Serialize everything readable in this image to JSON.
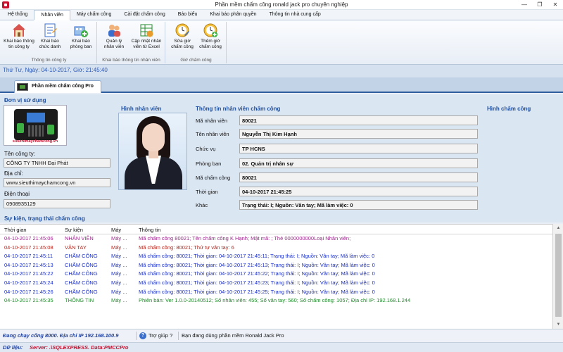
{
  "window": {
    "title": "Phần mềm chấm công ronald jack pro chuyên nghiệp",
    "minimize": "—",
    "maximize": "❐",
    "close": "✕"
  },
  "ribbon": {
    "tabs": [
      "Hệ thống",
      "Nhân viên",
      "Máy chấm công",
      "Cài đặt chấm công",
      "Báo biểu",
      "Khai báo  phân quyền",
      "Thông tin nhà cung cấp"
    ],
    "active_tab": 1,
    "groups": [
      {
        "label": "Thông tin công ty",
        "buttons": [
          {
            "label1": "Khai báo thông",
            "label2": "tin công ty",
            "icon": "house-icon"
          },
          {
            "label1": "Khai báo",
            "label2": "chức danh",
            "icon": "form-icon"
          },
          {
            "label1": "Khai báo",
            "label2": "phòng ban",
            "icon": "department-icon"
          }
        ]
      },
      {
        "label": "Khai báo thông tin nhân viên",
        "buttons": [
          {
            "label1": "Quản lý",
            "label2": "nhân viên",
            "icon": "people-icon"
          },
          {
            "label1": "Cập nhật nhân",
            "label2": "viên từ Excel",
            "icon": "excel-import-icon"
          }
        ]
      },
      {
        "label": "Giờ chấm công",
        "buttons": [
          {
            "label1": "Sửa giờ",
            "label2": "chấm công",
            "icon": "clock-edit-icon"
          },
          {
            "label1": "Thêm giờ",
            "label2": "chấm công",
            "icon": "clock-add-icon"
          }
        ]
      }
    ]
  },
  "date_line": "Thứ Tư, Ngày: 04-10-2017, Giờ: 21:45:40",
  "doc_tab": {
    "label": "Phần mềm chấm công Pro"
  },
  "unit": {
    "section_title": "Đơn vị sử dụng",
    "logo_caption": "sieuthimaychamcong.vn",
    "company_label": "Tên công ty:",
    "company_value": "CÔNG TY TNHH Đại Phát",
    "address_label": "Địa chỉ:",
    "address_value": "www.sieuthimaychamcong.vn",
    "phone_label": "Điện thoại",
    "phone_value": "0908935129"
  },
  "photo_title": "Hình nhân viên",
  "employee": {
    "section_title": "Thông tin nhân viên chấm công",
    "fields": [
      {
        "label": "Mã nhân viên",
        "value": "80021"
      },
      {
        "label": "Tên nhân viên",
        "value": "Nguyễn Thị Kim Hạnh"
      },
      {
        "label": "Chức vụ",
        "value": "TP HCNS"
      },
      {
        "label": "Phòng ban",
        "value": "02. Quản trị nhân sự"
      },
      {
        "label": "Mã chấm công",
        "value": "80021"
      },
      {
        "label": "Thời gian",
        "value": "04-10-2017 21:45:25"
      },
      {
        "label": "Khác",
        "value": "Trạng thái: I; Nguồn: Vân tay; Mã làm việc: 0"
      }
    ]
  },
  "attendance_image_title": "Hình chấm công",
  "events": {
    "section_title": "Sự kiện, trạng thái chấm công",
    "columns": [
      "Thời gian",
      "Sự kiện",
      "Máy",
      "Thông tin"
    ],
    "rows": [
      {
        "time": "04-10-2017 21:45:06",
        "event": "NHÂN VIÊN",
        "machine": "Máy ...",
        "info": "Mã chấm công 80021; Tên chấm công K Hạnh; Mật mã: ; Thẻ 0000000000Loại Nhân viên;",
        "color": "#a0268f"
      },
      {
        "time": "04-10-2017 21:45:08",
        "event": "VÂN TAY",
        "machine": "Máy ...",
        "info": "Mã chấm công: 80021; Thứ tự vân tay: 6",
        "color": "#b8231a"
      },
      {
        "time": "04-10-2017 21:45:11",
        "event": "CHẤM CÔNG",
        "machine": "Máy ...",
        "info": "Mã chấm công: 80021; Thời gian: 04-10-2017 21:45:11; Trạng thái: I; Nguồn: Vân tay; Mã làm việc: 0",
        "color": "#1a2fc4"
      },
      {
        "time": "04-10-2017 21:45:13",
        "event": "CHẤM CÔNG",
        "machine": "Máy ...",
        "info": "Mã chấm công: 80021; Thời gian: 04-10-2017 21:45:13; Trạng thái: I; Nguồn: Vân tay; Mã làm việc: 0",
        "color": "#1a2fc4"
      },
      {
        "time": "04-10-2017 21:45:22",
        "event": "CHẤM CÔNG",
        "machine": "Máy ...",
        "info": "Mã chấm công: 80021; Thời gian: 04-10-2017 21:45:22; Trạng thái: I; Nguồn: Vân tay; Mã làm việc: 0",
        "color": "#1a2fc4"
      },
      {
        "time": "04-10-2017 21:45:24",
        "event": "CHẤM CÔNG",
        "machine": "Máy ...",
        "info": "Mã chấm công: 80021; Thời gian: 04-10-2017 21:45:23; Trạng thái: I; Nguồn: Vân tay; Mã làm việc: 0",
        "color": "#1a2fc4"
      },
      {
        "time": "04-10-2017 21:45:26",
        "event": "CHẤM CÔNG",
        "machine": "Máy ...",
        "info": "Mã chấm công: 80021; Thời gian: 04-10-2017 21:45:25; Trạng thái: I; Nguồn: Vân tay; Mã làm việc: 0",
        "color": "#1a2fc4"
      },
      {
        "time": "04-10-2017 21:45:35",
        "event": "THÔNG TIN",
        "machine": "Máy ...",
        "info": "Phiên bản: Ver 1.0.0-20140512; Số nhân viên: 455; Số vân tay: 560; Số chấm công: 1057; Địa chỉ IP: 192.168.1.244",
        "color": "#1f8a2a"
      }
    ]
  },
  "status": {
    "port_text": "Đang chạy cổng 8000. Địa chỉ IP 192.168.100.9",
    "help_text": "Trợ giúp ?",
    "using_text": "Bạn đang dùng phần mềm Ronald Jack Pro",
    "data_label": "Dữ liệu:",
    "data_value": "Server: .\\SQLEXPRESS. Data:PMCCPro"
  },
  "colors": {
    "section_title": "#1f4f9e",
    "date_text": "#2d5bb7",
    "status_text": "#1f3f9e",
    "data_value": "#c8102e"
  }
}
